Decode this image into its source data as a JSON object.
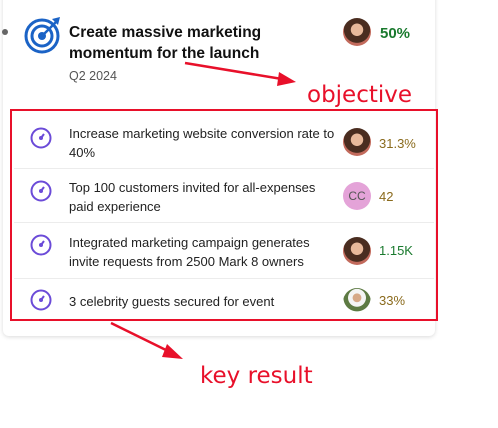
{
  "objective": {
    "title": "Create massive marketing momentum for the launch",
    "date": "Q2 2024",
    "progress": "50%",
    "icon": "target-icon"
  },
  "key_results": [
    {
      "text": "Increase marketing website conversion rate to 40%",
      "progress": "31.3%",
      "owner": "avatar-woman"
    },
    {
      "text": "Top 100 customers invited for all-expenses paid experience",
      "progress": "42",
      "owner_initials": "CC"
    },
    {
      "text": "Integrated marketing campaign generates invite requests from 2500 Mark 8 owners",
      "progress": "1.15K",
      "owner": "avatar-woman"
    },
    {
      "text": "3 celebrity guests secured for event",
      "progress": "33%",
      "owner": "avatar-man"
    }
  ],
  "annotations": {
    "objective": "objective",
    "key_result": "key result"
  },
  "colors": {
    "annotation_red": "#e8102a",
    "progress_green": "#1a7a2e",
    "progress_amber": "#8a6a1c",
    "icon_purple": "#6b4bd8",
    "icon_blue": "#1b63c6"
  }
}
